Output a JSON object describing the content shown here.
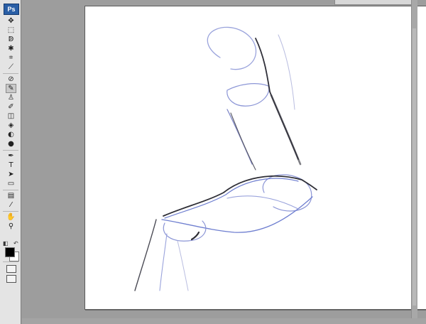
{
  "app": {
    "logo_text": "Ps",
    "options_value": ""
  },
  "toolbox": {
    "tools": [
      {
        "name": "move-tool-icon",
        "glyph": "✥"
      },
      {
        "name": "marquee-tool-icon",
        "glyph": "⬚"
      },
      {
        "name": "lasso-tool-icon",
        "glyph": "ↁ"
      },
      {
        "name": "magic-wand-tool-icon",
        "glyph": "✱"
      },
      {
        "name": "crop-tool-icon",
        "glyph": "⌗"
      },
      {
        "name": "slice-tool-icon",
        "glyph": "⟋"
      },
      {
        "name": "healing-brush-tool-icon",
        "glyph": "⊘"
      },
      {
        "name": "brush-tool-icon",
        "glyph": "✎"
      },
      {
        "name": "clone-stamp-tool-icon",
        "glyph": "♙"
      },
      {
        "name": "history-brush-tool-icon",
        "glyph": "✐"
      },
      {
        "name": "eraser-tool-icon",
        "glyph": "◫"
      },
      {
        "name": "gradient-tool-icon",
        "glyph": "◈"
      },
      {
        "name": "blur-tool-icon",
        "glyph": "◐"
      },
      {
        "name": "dodge-tool-icon",
        "glyph": "●"
      },
      {
        "name": "pen-tool-icon",
        "glyph": "✒"
      },
      {
        "name": "type-tool-icon",
        "glyph": "T"
      },
      {
        "name": "path-selection-tool-icon",
        "glyph": "➤"
      },
      {
        "name": "rectangle-tool-icon",
        "glyph": "▭"
      },
      {
        "name": "notes-tool-icon",
        "glyph": "▤"
      },
      {
        "name": "eyedropper-tool-icon",
        "glyph": "⁄"
      },
      {
        "name": "hand-tool-icon",
        "glyph": "✋"
      },
      {
        "name": "zoom-tool-icon",
        "glyph": "⚲"
      }
    ],
    "active_tool": "brush-tool-icon",
    "foreground_color": "#000000",
    "background_color": "#ffffff",
    "default_colors_glyph": "◧",
    "swap_colors_glyph": "↶"
  },
  "colors": {
    "workspace": "#9d9d9d",
    "toolbox": "#e4e4e4",
    "canvas": "#ffffff",
    "sketch_dark": "#2e2e36",
    "sketch_blue": "#6f7fd0",
    "sketch_light": "#b9bde0"
  }
}
